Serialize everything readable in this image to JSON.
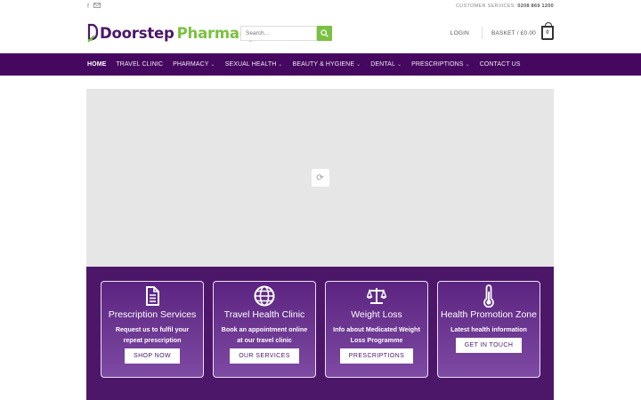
{
  "topbar": {
    "social_icons": [
      "facebook-icon",
      "email-icon"
    ],
    "customer_services_label": "CUSTOMER SERVICES:",
    "customer_services_phone": "0208 869 1200"
  },
  "logo": {
    "part1": "Doorstep",
    "part2": "Pharmacy"
  },
  "search": {
    "placeholder": "Search..."
  },
  "header": {
    "login": "LOGIN",
    "basket": "BASKET / £0.00",
    "basket_count": "0"
  },
  "nav": [
    {
      "label": "HOME",
      "dropdown": false
    },
    {
      "label": "TRAVEL CLINIC",
      "dropdown": false
    },
    {
      "label": "PHARMACY",
      "dropdown": true
    },
    {
      "label": "SEXUAL HEALTH",
      "dropdown": true
    },
    {
      "label": "BEAUTY & HYGIENE",
      "dropdown": true
    },
    {
      "label": "DENTAL",
      "dropdown": true
    },
    {
      "label": "PRESCRIPTIONS",
      "dropdown": true
    },
    {
      "label": "CONTACT US",
      "dropdown": false
    }
  ],
  "cards": [
    {
      "icon": "document-icon",
      "title": "Prescription Services",
      "desc": "Request us to fulfil your repeat prescription",
      "button": "SHOP NOW"
    },
    {
      "icon": "globe-icon",
      "title": "Travel Health Clinic",
      "desc": "Book an appointment online at our travel clinic",
      "button": "OUR SERVICES"
    },
    {
      "icon": "scales-icon",
      "title": "Weight Loss",
      "desc": "Info about Medicated Weight Loss Programme",
      "button": "PRESCRIPTIONS"
    },
    {
      "icon": "thermometer-icon",
      "title": "Health Promotion Zone",
      "desc": "Latest health information",
      "button": "GET IN TOUCH"
    }
  ],
  "colors": {
    "brand_purple": "#45075f",
    "brand_green": "#7ac142"
  }
}
